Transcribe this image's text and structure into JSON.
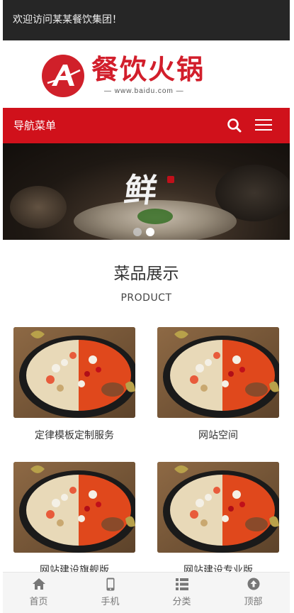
{
  "topbar": {
    "welcome": "欢迎访问某某餐饮集团！"
  },
  "logo": {
    "title": "餐饮火锅",
    "subtitle": "— www.baidu.com —"
  },
  "navbar": {
    "title": "导航菜单",
    "search_icon": "search-icon",
    "menu_icon": "hamburger-menu-icon"
  },
  "banner": {
    "slide_text": "鲜",
    "slide_count": 2,
    "active_slide": 2
  },
  "products": {
    "title": "菜品展示",
    "subtitle": "PRODUCT",
    "items": [
      {
        "caption": "定律模板定制服务"
      },
      {
        "caption": "网站空间"
      },
      {
        "caption": "网站建设旗舰版"
      },
      {
        "caption": "网站建设专业版"
      }
    ]
  },
  "tabbar": {
    "items": [
      {
        "label": "首页",
        "icon": "home-icon"
      },
      {
        "label": "手机",
        "icon": "phone-icon"
      },
      {
        "label": "分类",
        "icon": "list-icon"
      },
      {
        "label": "顶部",
        "icon": "arrow-up-icon"
      }
    ]
  },
  "colors": {
    "brand_red": "#d0111b",
    "topbar_dark": "#262626"
  }
}
